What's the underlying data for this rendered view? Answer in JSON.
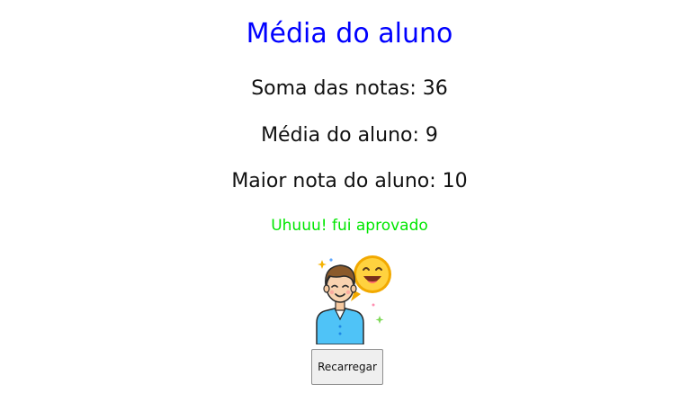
{
  "header": {
    "title": "Média do aluno"
  },
  "stats": {
    "sum": "Soma das notas: 36",
    "average": "Média do aluno: 9",
    "highest": "Maior nota do aluno: 10"
  },
  "result": {
    "message": "Uhuuu! fui aprovado",
    "icon": "happy-student-icon"
  },
  "actions": {
    "reload_label": "Recarregar"
  },
  "colors": {
    "title": "#0000ff",
    "status": "#00e600",
    "text": "#111111"
  }
}
